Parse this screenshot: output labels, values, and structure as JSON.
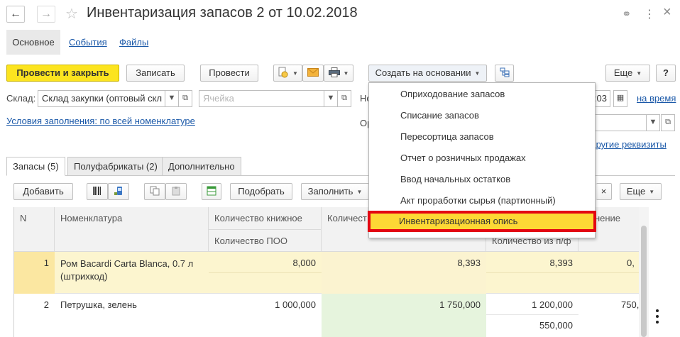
{
  "window": {
    "title": "Инвентаризация запасов 2 от 10.02.2018",
    "back_glyph": "←",
    "forward_glyph": "→",
    "star_glyph": "☆",
    "link_glyph": "⚭",
    "more_glyph": "⋮",
    "close_glyph": "×"
  },
  "section_tabs": [
    "Основное",
    "События",
    "Файлы"
  ],
  "toolbar": {
    "post_close": "Провести и закрыть",
    "save": "Записать",
    "post": "Провести",
    "create_based": "Создать на основании",
    "more": "Еще",
    "help": "?"
  },
  "fields": {
    "warehouse_label": "Склад:",
    "warehouse_value": "Склад закупки (оптовый скл",
    "cell_placeholder": "Ячейка",
    "number_label_partial": "Но",
    "org_label_partial": "Ор",
    "time_partial": ":03",
    "on_time_link": "на время",
    "fill_conditions_link": "Условия заполнения: по всей номенклатуре",
    "other_requisites_link": "другие реквизиты"
  },
  "inner_tabs": [
    "Запасы (5)",
    "Полуфабрикаты (2)",
    "Дополнительно"
  ],
  "table_toolbar": {
    "add": "Добавить",
    "pick": "Подобрать",
    "fill": "Заполнить",
    "more": "Еще",
    "clear_glyph": "×"
  },
  "table": {
    "headers": {
      "n": "N",
      "nomenclature": "Номенклатура",
      "qty_book": "Количество книжное",
      "qty_poo": "Количество ПОО",
      "qty_partial": "Количест",
      "qty_pf": "Количество из п/ф",
      "deviation_partial": "лонение"
    },
    "rows": [
      {
        "n": "1",
        "name": "Ром Bacardi Carta Blanca, 0.7 л (штрихкод)",
        "qty_book": "8,000",
        "qty_actual": "8,393",
        "qty_pf": "8,393",
        "deviation": "0,"
      },
      {
        "n": "2",
        "name": "Петрушка, зелень",
        "qty_book": "1 000,000",
        "qty_actual": "1 750,000",
        "qty_pf": "1 200,000",
        "qty_pf2": "550,000",
        "deviation": "750,"
      }
    ]
  },
  "dropdown_menu": {
    "items": [
      "Оприходование запасов",
      "Списание запасов",
      "Пересортица запасов",
      "Отчет о розничных продажах",
      "Ввод начальных остатков",
      "Акт проработки сырья (партионный)",
      "Инвентаризационная опись"
    ],
    "highlighted_index": 6
  },
  "colors": {
    "accent_yellow": "#fce41f",
    "highlight_border": "#e30613",
    "link_blue": "#1a58a8",
    "row_selected": "#fcf5cf",
    "cell_green": "#e6f4dd"
  }
}
